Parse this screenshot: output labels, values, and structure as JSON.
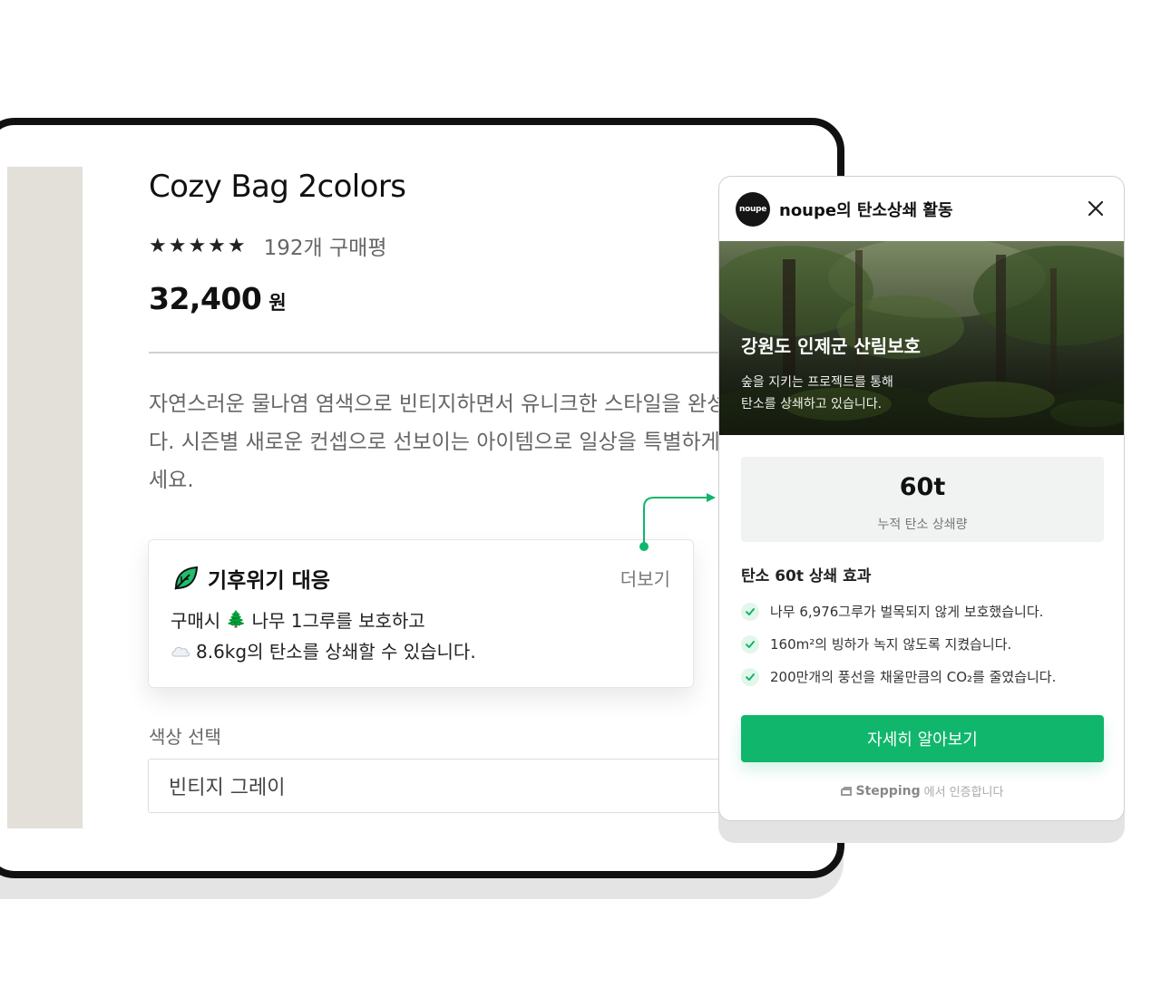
{
  "product": {
    "title": "Cozy Bag 2colors",
    "rating_stars": "★★★★★",
    "rating": 5,
    "reviews": "192개 구매평",
    "price": "32,400",
    "price_unit": "원",
    "description_lines": [
      "자연스러운 물나염 염색으로 빈티지하면서 유니크한 스타일을 완성",
      "다. 시즌별 새로운 컨셉으로 선보이는 아이템으로 일상을 특별하게",
      "세요."
    ],
    "color_label": "색상 선택",
    "color_value": "빈티지 그레이"
  },
  "climate_card": {
    "icon": "leaf-icon",
    "title": "기후위기 대응",
    "more": "더보기",
    "line1": {
      "prefix": "구매시",
      "icon": "tree-icon",
      "text": "나무 1그루를 보호하고"
    },
    "line2": {
      "icon": "cloud-icon",
      "text": "8.6kg의 탄소를 상쇄할 수 있습니다."
    }
  },
  "popup": {
    "brand_logo": "noupe",
    "title": "noupe의 탄소상쇄 활동",
    "hero": {
      "title": "강원도 인제군 산림보호",
      "subtitle_lines": [
        "숲을 지키는 프로젝트를 통해",
        "탄소를 상쇄하고 있습니다."
      ]
    },
    "stat": {
      "value": "60t",
      "label": "누적 탄소 상쇄량"
    },
    "effect_title": "탄소 60t 상쇄 효과",
    "effects": [
      "나무 6,976그루가 벌목되지 않게 보호했습니다.",
      "160m²의 빙하가 녹지 않도록 지켰습니다.",
      "200만개의 풍선을 채울만큼의 CO₂를 줄였습니다."
    ],
    "cta": "자세히 알아보기",
    "footer": {
      "brand": "Stepping",
      "text": "에서 인증합니다"
    }
  },
  "colors": {
    "accent": "#0fb66b",
    "frame": "#111111",
    "product_bg": "#e3e0da"
  }
}
